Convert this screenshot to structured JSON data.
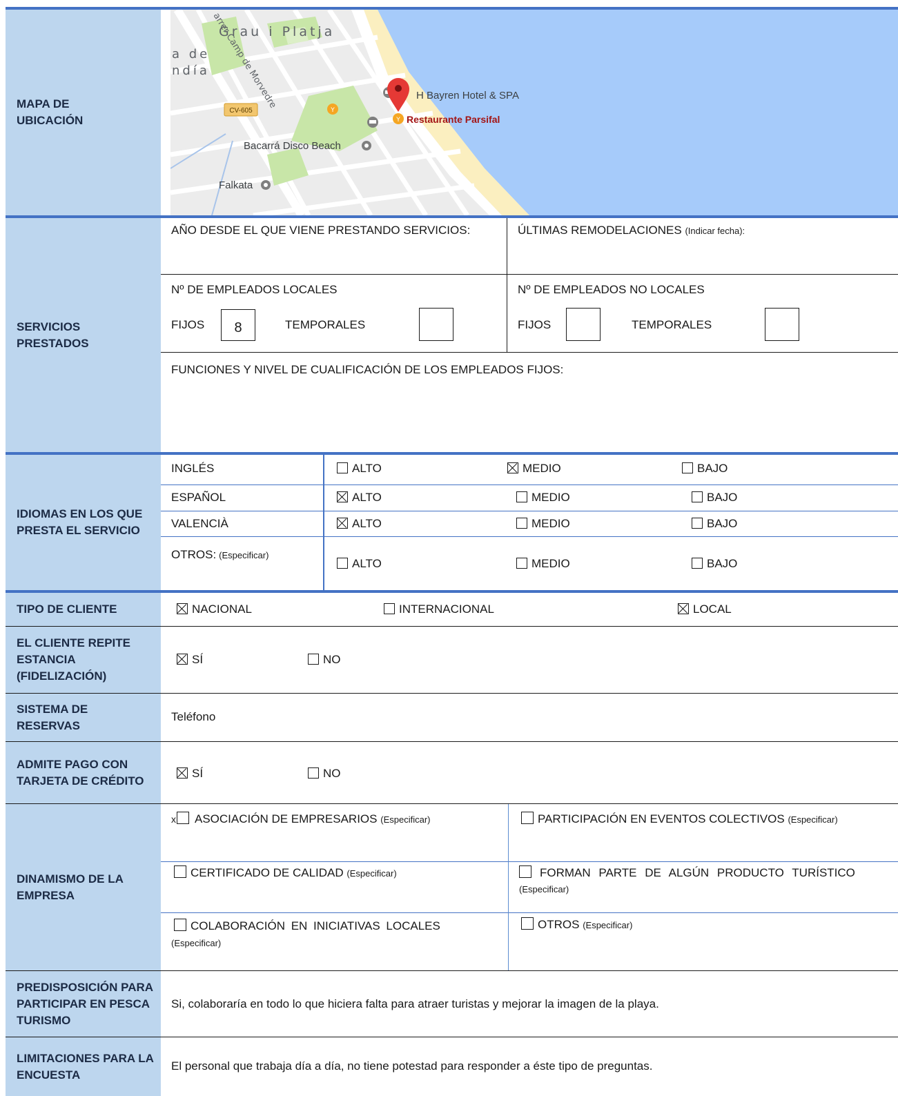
{
  "labels": {
    "mapa": "MAPA DE UBICACIÓN",
    "servicios": "SERVICIOS PRESTADOS",
    "idiomas": "IDIOMAS EN LOS QUE PRESTA EL SERVICIO",
    "tipo_cliente": "TIPO DE CLIENTE",
    "repite": "EL CLIENTE REPITE ESTANCIA (FIDELIZACIÓN)",
    "reservas": "SISTEMA DE RESERVAS",
    "pago": "ADMITE PAGO CON TARJETA DE CRÉDITO",
    "dinamismo": "DINAMISMO DE LA EMPRESA",
    "predisposicion": "PREDISPOSICIÓN PARA PARTICIPAR EN PESCA TURISMO",
    "limitaciones": "LIMITACIONES PARA LA ENCUESTA"
  },
  "map": {
    "area": "Grau i Platja",
    "area_left1": "a de",
    "area_left2": "ndía",
    "street": "arrer Camp de Morvedre",
    "road": "CV-605",
    "hotel": "H Bayren Hotel & SPA",
    "restaurant": "Restaurante Parsifal",
    "disco": "Bacarrá Disco Beach",
    "falkata": "Falkata",
    "colors": {
      "sea": "#a6cbfa",
      "sand": "#fbefc0",
      "park": "#c8e6a8",
      "road_label": "#f2c66e",
      "marker": "#e53935",
      "restaurant_text": "#a31515"
    }
  },
  "servicios": {
    "anio_label": "AÑO DESDE EL QUE VIENE PRESTANDO SERVICIOS:",
    "remodel_label": "ÚLTIMAS REMODELACIONES",
    "remodel_note": "(Indicar fecha):",
    "empleados_locales": "Nº DE EMPLEADOS LOCALES",
    "empleados_no_locales": "Nº DE EMPLEADOS NO LOCALES",
    "fijos": "FIJOS",
    "temporales": "TEMPORALES",
    "fijos_locales_value": "8",
    "temporales_locales_value": "",
    "fijos_no_locales_value": "",
    "temporales_no_locales_value": "",
    "funciones": "FUNCIONES Y NIVEL DE CUALIFICACIÓN DE LOS EMPLEADOS FIJOS:"
  },
  "idiomas": {
    "otros_note": "(Especificar)",
    "levels": [
      "ALTO",
      "MEDIO",
      "BAJO"
    ],
    "rows": [
      {
        "name": "INGLÉS",
        "alto": false,
        "medio": true,
        "bajo": false
      },
      {
        "name": "ESPAÑOL",
        "alto": true,
        "medio": false,
        "bajo": false
      },
      {
        "name": "VALENCIÀ",
        "alto": true,
        "medio": false,
        "bajo": false
      },
      {
        "name": "OTROS:",
        "alto": false,
        "medio": false,
        "bajo": false
      }
    ]
  },
  "tipo_cliente": {
    "nacional": "NACIONAL",
    "internacional": "INTERNACIONAL",
    "local": "LOCAL"
  },
  "si": "SÍ",
  "no": "NO",
  "reservas_value": "Teléfono",
  "dinamismo": {
    "asociacion_prefix": "x",
    "asociacion": "ASOCIACIÓN DE EMPRESARIOS",
    "participacion": "PARTICIPACIÓN EN EVENTOS COLECTIVOS",
    "certificado": "CERTIFICADO DE CALIDAD",
    "producto": "FORMAN PARTE DE ALGÚN PRODUCTO TURÍSTICO",
    "colaboracion": "COLABORACIÓN EN INICIATIVAS LOCALES",
    "otros": "OTROS",
    "especificar": "(Especificar)"
  },
  "predisposicion_value": "Si, colaboraría en todo lo que hiciera falta para atraer turistas y mejorar la imagen de la playa.",
  "limitaciones_value": "El personal que trabaja día a día, no tiene potestad para responder a éste tipo de preguntas."
}
